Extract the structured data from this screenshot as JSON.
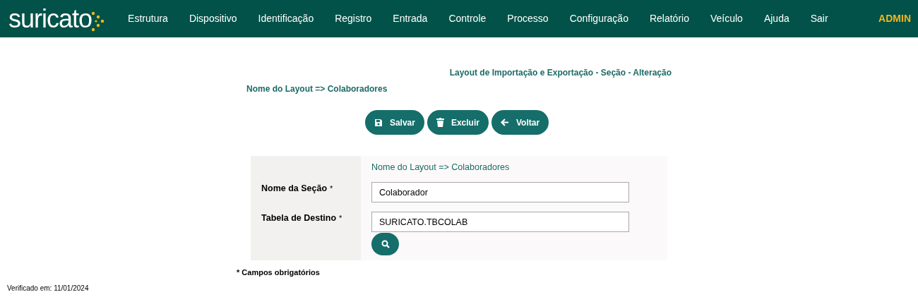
{
  "brand": {
    "name": "suricato"
  },
  "menu": [
    {
      "label": "Estrutura"
    },
    {
      "label": "Dispositivo"
    },
    {
      "label": "Identificação"
    },
    {
      "label": "Registro"
    },
    {
      "label": "Entrada"
    },
    {
      "label": "Controle"
    },
    {
      "label": "Processo"
    },
    {
      "label": "Configuração"
    },
    {
      "label": "Relatório"
    },
    {
      "label": "Veículo"
    },
    {
      "label": "Ajuda"
    },
    {
      "label": "Sair"
    }
  ],
  "user": "ADMIN",
  "page_title": "Layout de Importação e Exportação - Seção - Alteração",
  "subtitle": "Nome do Layout => Colaboradores",
  "actions": [
    {
      "label": "Salvar",
      "kind": "save"
    },
    {
      "label": "Excluir",
      "kind": "delete"
    },
    {
      "label": "Voltar",
      "kind": "back"
    }
  ],
  "form": {
    "header": "Nome do Layout => Colaboradores",
    "fields": [
      {
        "label": "Nome da Seção",
        "required_mark": "*",
        "value": "Colaborador",
        "lookup": false
      },
      {
        "label": "Tabela de Destino",
        "required_mark": "*",
        "value": "SURICATO.TBCOLAB",
        "lookup": true
      }
    ]
  },
  "required_note": "* Campos obrigatórios",
  "footer": "Verificado em: 11/01/2024"
}
